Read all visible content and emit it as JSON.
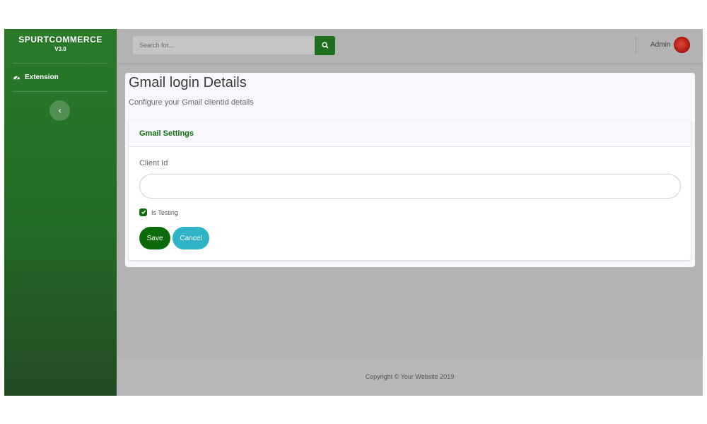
{
  "sidebar": {
    "brand_name": "SPURTCOMMERCE",
    "brand_version": "V3.0",
    "items": [
      {
        "label": "Extension",
        "icon": "dashboard-gauge-icon"
      }
    ],
    "collapse_icon": "chevron-left-icon"
  },
  "topbar": {
    "search_placeholder": "Search for...",
    "search_icon": "search-icon",
    "user_name": "Admin"
  },
  "page": {
    "title": "Gmail login Details",
    "subtitle": "Configure your Gmail clientId details"
  },
  "settings": {
    "header": "Gmail Settings",
    "client_id_label": "Client Id",
    "client_id_value": "",
    "is_testing_label": "Is Testing",
    "is_testing_checked": true,
    "save_label": "Save",
    "cancel_label": "Cancel"
  },
  "footer": {
    "copyright": "Copyright © Your Website 2019"
  },
  "colors": {
    "sidebar_top": "#2a7a2a",
    "sidebar_bottom": "#244a26",
    "primary_green": "#0b6b0b",
    "cancel_cyan": "#2fb3c6",
    "overlay_gray": "#b3b3b4"
  }
}
